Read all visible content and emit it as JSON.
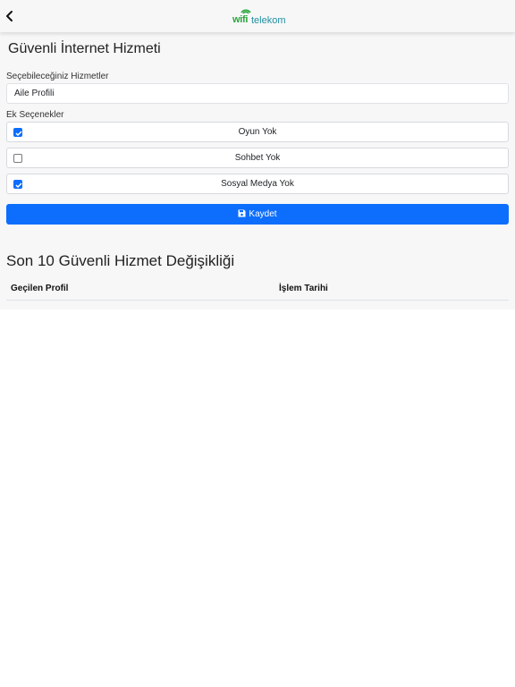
{
  "header": {
    "logo_wifi": "wifi",
    "logo_rest": "telekom",
    "back_icon": "chevron-left-icon"
  },
  "page": {
    "title": "Güvenli İnternet Hizmeti"
  },
  "services": {
    "label": "Seçebileceğiniz Hizmetler",
    "selected": "Aile Profili"
  },
  "extras": {
    "label": "Ek Seçenekler",
    "options": [
      {
        "label": "Oyun Yok",
        "checked": true
      },
      {
        "label": "Sohbet Yok",
        "checked": false
      },
      {
        "label": "Sosyal Medya Yok",
        "checked": true
      }
    ]
  },
  "save": {
    "label": "Kaydet",
    "icon": "floppy-disk-icon"
  },
  "history": {
    "title": "Son 10 Güvenli Hizmet Değişikliği",
    "columns": [
      "Geçilen Profil",
      "İşlem Tarihi"
    ]
  },
  "colors": {
    "primary": "#0d6efd",
    "brand_green": "#2aa63a",
    "brand_teal": "#1f8fa0"
  }
}
